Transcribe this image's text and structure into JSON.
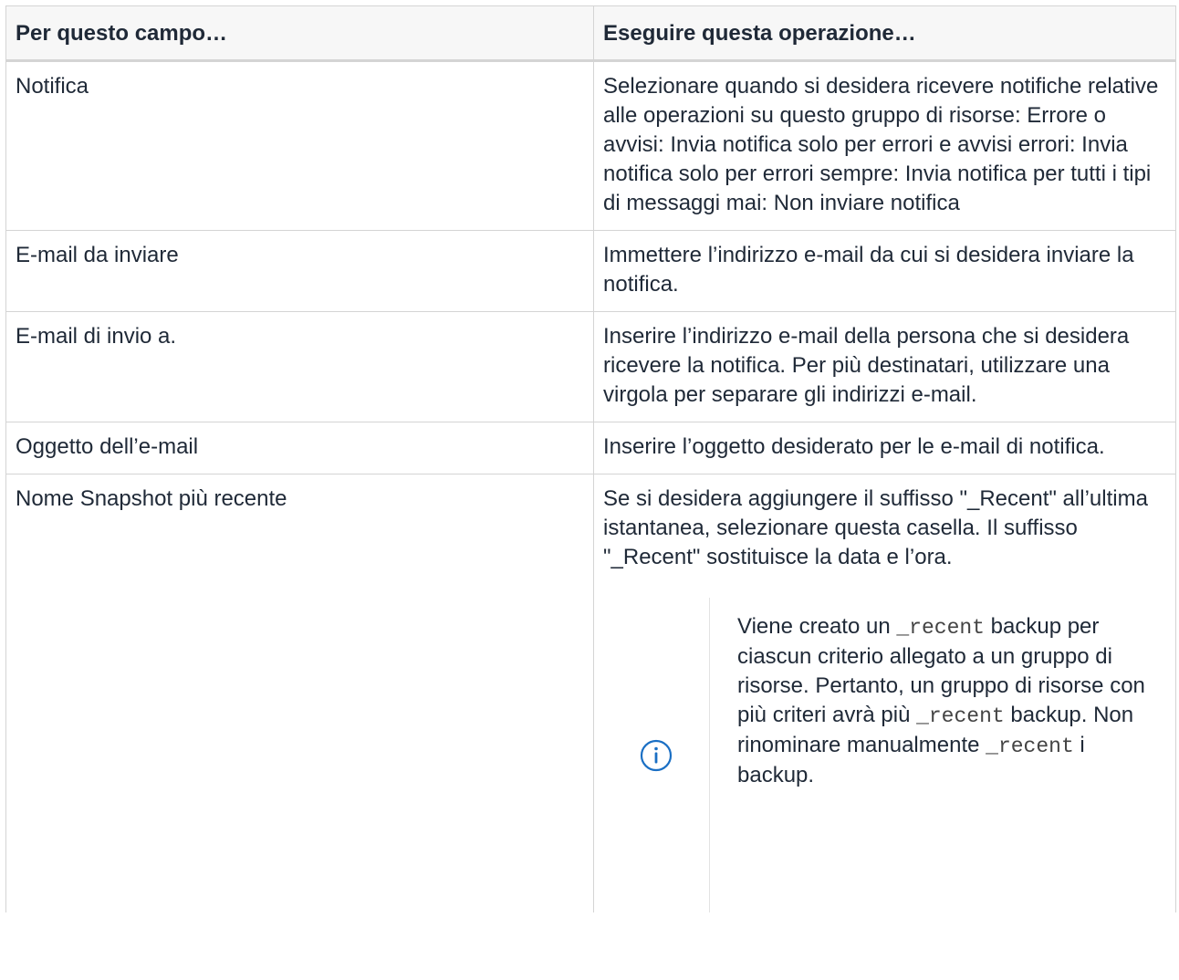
{
  "table": {
    "headers": [
      "Per questo campo…",
      "Eseguire questa operazione…"
    ],
    "rows": [
      {
        "field": "Notifica",
        "action": "Selezionare quando si desidera ricevere notifiche relative alle operazioni su questo gruppo di risorse: Errore o avvisi: Invia notifica solo per errori e avvisi errori: Invia notifica solo per errori sempre: Invia notifica per tutti i tipi di messaggi mai: Non inviare notifica"
      },
      {
        "field": "E-mail da inviare",
        "action": "Immettere l’indirizzo e-mail da cui si desidera inviare la notifica."
      },
      {
        "field": "E-mail di invio a.",
        "action": "Inserire l’indirizzo e-mail della persona che si desidera ricevere la notifica. Per più destinatari, utilizzare una virgola per separare gli indirizzi e-mail."
      },
      {
        "field": "Oggetto dell’e-mail",
        "action": "Inserire l’oggetto desiderato per le e-mail di notifica."
      },
      {
        "field": "Nome Snapshot più recente",
        "action": "Se si desidera aggiungere il suffisso \"_Recent\" all’ultima istantanea, selezionare questa casella. Il suffisso \"_Recent\" sostituisce la data e l’ora."
      }
    ]
  },
  "note": {
    "icon": "info-circle-icon",
    "text_1": "Viene creato un ",
    "code_1": "_recent",
    "text_2": " backup per ciascun criterio allegato a un gruppo di risorse. Pertanto, un gruppo di risorse con più criteri avrà più ",
    "code_2": "_recent",
    "text_3": " backup. Non rinominare manualmente ",
    "code_3": "_recent",
    "text_4": " i backup."
  },
  "colors": {
    "border": "#d4d4d4",
    "header_bg": "#f7f7f7",
    "text": "#1f2937",
    "icon": "#1a6fc4"
  }
}
